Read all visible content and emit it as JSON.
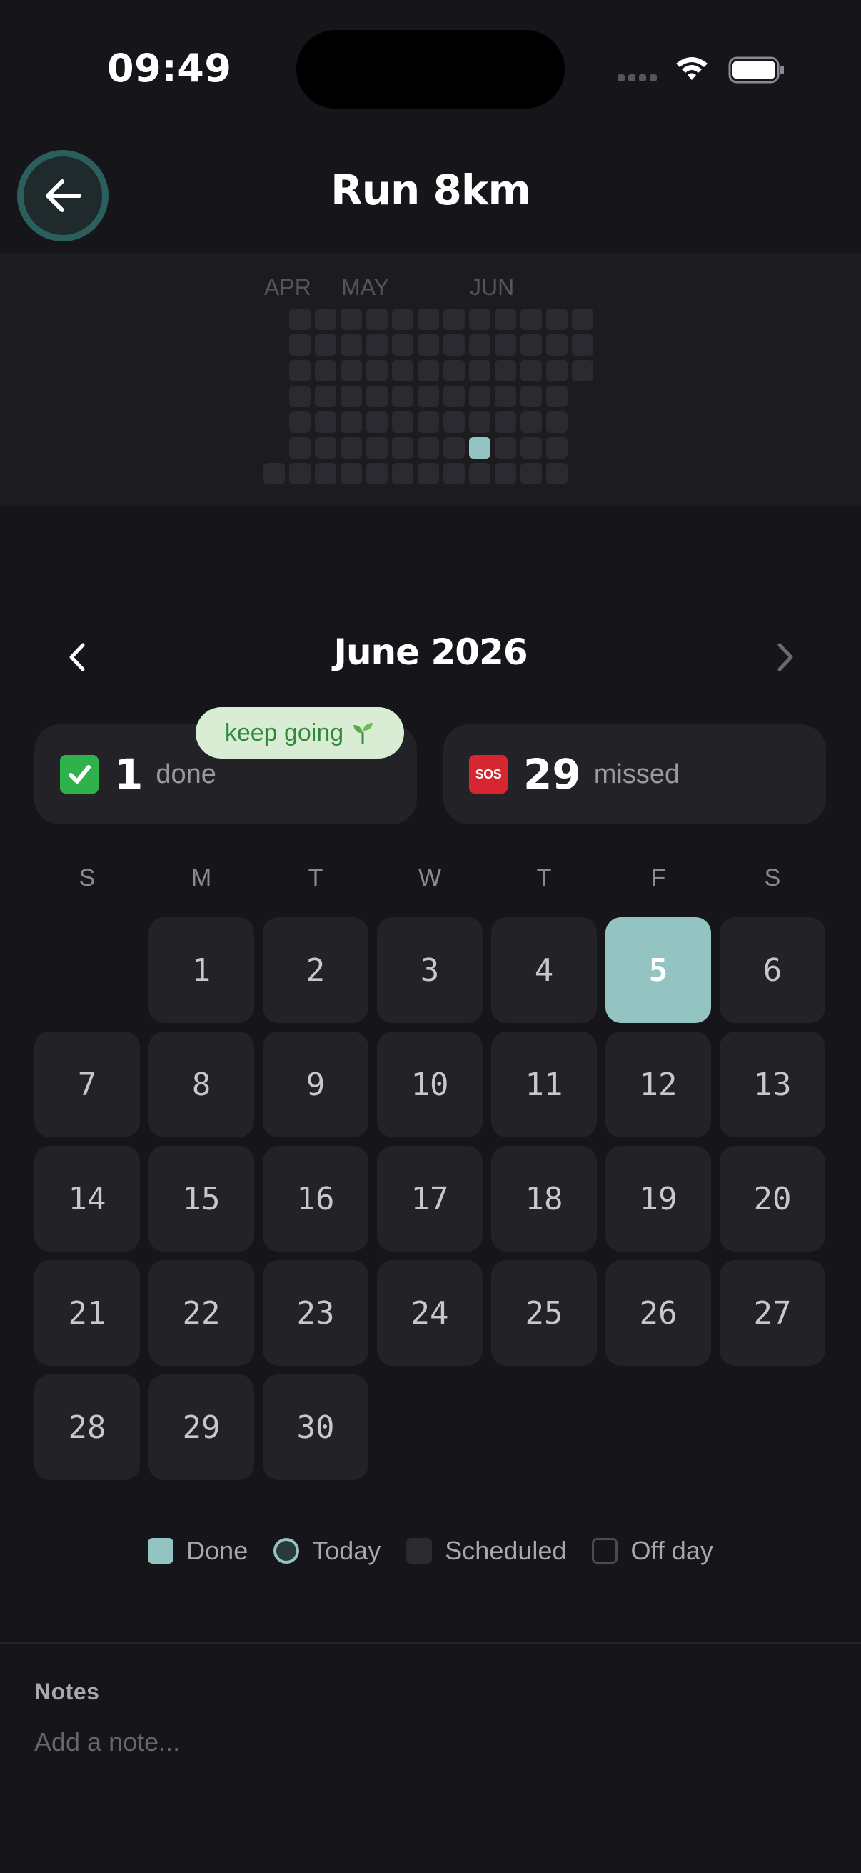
{
  "status": {
    "time": "09:49"
  },
  "header": {
    "title": "Run 8km"
  },
  "heatmap": {
    "months": [
      "APR",
      "MAY",
      "JUN"
    ],
    "done_weeks_from_start": 8,
    "done_day_of_week": 5
  },
  "calendar": {
    "month_title": "June 2026",
    "weekdays": [
      "S",
      "M",
      "T",
      "W",
      "T",
      "F",
      "S"
    ],
    "first_weekday": 1,
    "days": [
      "1",
      "2",
      "3",
      "4",
      "5",
      "6",
      "7",
      "8",
      "9",
      "10",
      "11",
      "12",
      "13",
      "14",
      "15",
      "16",
      "17",
      "18",
      "19",
      "20",
      "21",
      "22",
      "23",
      "24",
      "25",
      "26",
      "27",
      "28",
      "29",
      "30"
    ],
    "today": "5"
  },
  "stats": {
    "done_count": "1",
    "done_label": "done",
    "missed_count": "29",
    "missed_label": "missed",
    "badge": "keep going",
    "badge_icon": "seedling",
    "sos_label": "SOS"
  },
  "legend": [
    {
      "label": "Done",
      "type": "done",
      "color": "#93c4c2"
    },
    {
      "label": "Today",
      "type": "today",
      "color": "#93c4c2"
    },
    {
      "label": "Scheduled",
      "type": "scheduled",
      "color": "#2a2a30"
    },
    {
      "label": "Off day",
      "type": "off",
      "color": "#4a4a50"
    }
  ],
  "notes": {
    "label": "Notes",
    "placeholder": "Add a note..."
  },
  "colors": {
    "accent": "#93c4c2",
    "background": "#15151a",
    "card": "#222227"
  }
}
